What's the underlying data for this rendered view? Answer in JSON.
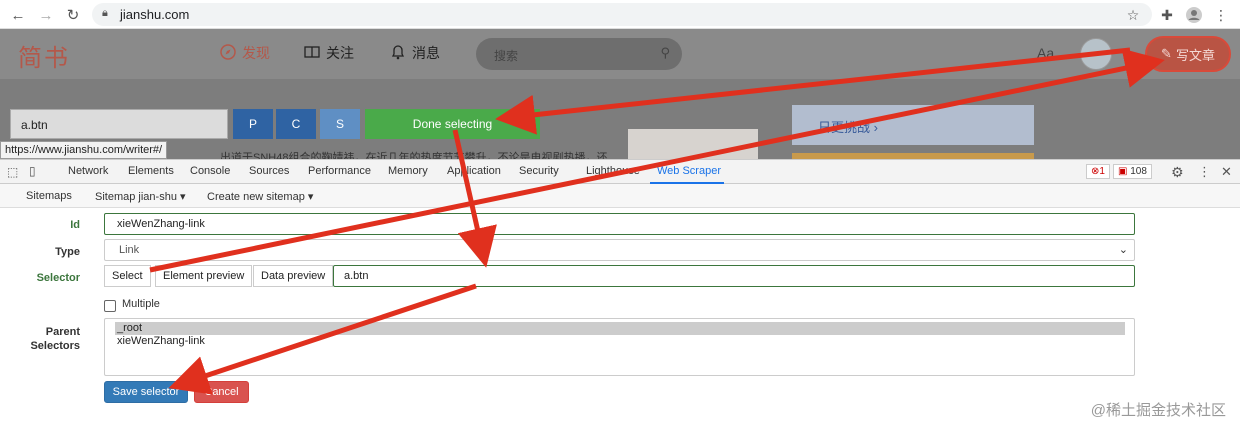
{
  "browser": {
    "url": "jianshu.com",
    "icons": [
      "back-icon",
      "forward-icon",
      "reload-icon",
      "lock-icon",
      "star-icon",
      "puzzle-icon",
      "profile-icon",
      "kebab-icon"
    ]
  },
  "site": {
    "logo": "简书",
    "nav": {
      "discover": "发现",
      "follow": "关注",
      "messages": "消息"
    },
    "search_placeholder": "搜索",
    "aa": "Aa",
    "write_button": "写文章",
    "bg_snippet": "出道于SNH48组合的鞠婧祎，在近几年的热度节节攀升，不论是电视剧热播，还",
    "bg_card_text": "日更挑战 ›"
  },
  "selector_bar": {
    "input_value": "a.btn",
    "p_label": "P",
    "c_label": "C",
    "s_label": "S",
    "done_label": "Done selecting",
    "link_tooltip": "https://www.jianshu.com/writer#/"
  },
  "devtools": {
    "tabs": [
      "Network",
      "Elements",
      "Console",
      "Sources",
      "Performance",
      "Memory",
      "Application",
      "Security",
      "Lighthouse",
      "Web Scraper"
    ],
    "active_tab": "Web Scraper",
    "error_count": "1",
    "warning_count": "108"
  },
  "scraper_menu": {
    "sitemaps": "Sitemaps",
    "sitemap_current": "Sitemap jian-shu ▾",
    "create": "Create new sitemap ▾"
  },
  "form": {
    "id_label": "Id",
    "id_value": "xieWenZhang-link",
    "type_label": "Type",
    "type_value": "Link",
    "selector_label": "Selector",
    "select_btn": "Select",
    "element_preview_btn": "Element preview",
    "data_preview_btn": "Data preview",
    "selector_value": "a.btn",
    "multiple_label": "Multiple",
    "multiple_checked": false,
    "parent_label_1": "Parent",
    "parent_label_2": "Selectors",
    "parent_options": [
      "_root",
      "xieWenZhang-link"
    ],
    "parent_selected": "_root",
    "save_label": "Save selector",
    "cancel_label": "Cancel"
  },
  "watermark": "@稀土掘金技术社区",
  "colors": {
    "accent_red": "#e0301e",
    "brand": "#ea6f5a",
    "done_green": "#4aaa4a",
    "primary_blue": "#337ab7",
    "danger": "#d9534f"
  }
}
